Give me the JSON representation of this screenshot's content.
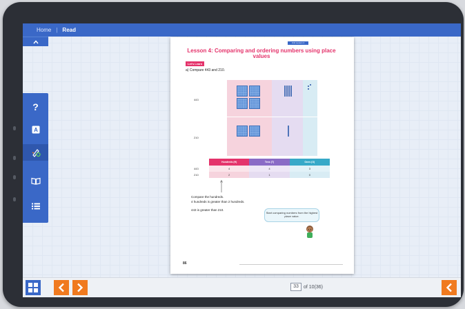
{
  "breadcrumb": {
    "home": "Home",
    "separator": "|",
    "current": "Read"
  },
  "toolbar": {
    "collapse_icon": "chevron-up-icon",
    "tools": [
      "help-icon",
      "translate-icon",
      "highlighter-icon",
      "book-icon",
      "list-icon"
    ]
  },
  "page": {
    "tag": "Unit Lesson 4",
    "title": "Lesson 4: Comparing and ordering numbers using place values",
    "badge": "Let's Learn",
    "question": "a)   Compare 443 and 210.",
    "row_labels": [
      "443",
      "210"
    ],
    "table": {
      "headers": [
        "Hundreds (H)",
        "Tens (T)",
        "Ones (O)"
      ],
      "rows": [
        {
          "label": "443",
          "values": [
            "4",
            "4",
            "3"
          ]
        },
        {
          "label": "210",
          "values": [
            "2",
            "1",
            "0"
          ]
        }
      ]
    },
    "compare_line1": "Compare the hundreds.",
    "compare_line2": "4 hundreds is greater than 2 hundreds.",
    "conclusion": "443 is greater than 210.",
    "bubble": "Start comparing numbers from the highest place value.",
    "page_number": "86"
  },
  "pagination": {
    "current": "33",
    "total_label": "of 10(36)"
  },
  "colors": {
    "brand": "#3a68c7",
    "accent": "#f07a1f",
    "lesson": "#e4336b"
  }
}
